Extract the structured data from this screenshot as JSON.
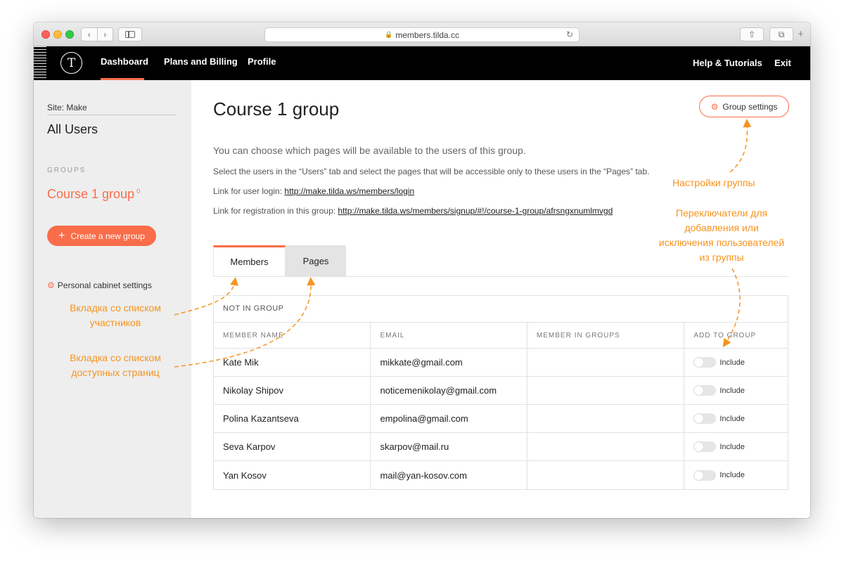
{
  "browser": {
    "url": "members.tilda.cc",
    "back_glyph": "‹",
    "forward_glyph": "›",
    "reload_glyph": "↻",
    "lock_glyph": "🔒",
    "share_glyph": "⇧",
    "tabs_glyph": "⧉",
    "new_tab_glyph": "+"
  },
  "appbar": {
    "logo_glyph": "T",
    "nav": [
      "Dashboard",
      "Plans and Billing",
      "Profile"
    ],
    "help_label": "Help & Tutorials",
    "exit_label": "Exit"
  },
  "sidebar": {
    "site_label": "Site: Make",
    "all_users": "All Users",
    "groups_heading": "GROUPS",
    "group_name": "Course 1 group",
    "group_count": "0",
    "create_group_label": "Create a new group",
    "cabinet_settings_label": "Personal cabinet settings"
  },
  "main": {
    "title": "Course 1 group",
    "group_settings_label": "Group settings",
    "lead": "You can choose which pages will be available to the users of this group.",
    "select_instruction": "Select the users in the “Users” tab and select the pages that will be accessible only to these users in the “Pages” tab.",
    "login_prefix": "Link for user login: ",
    "login_url": "http://make.tilda.ws/members/login",
    "reg_prefix": "Link for registration in this group: ",
    "reg_url": "http://make.tilda.ws/members/signup/#!/course-1-group/afrsngxnumlmvgd",
    "tabs": [
      "Members",
      "Pages"
    ]
  },
  "table": {
    "section_title": "NOT IN GROUP",
    "headers": [
      "MEMBER NAME",
      "EMAIL",
      "MEMBER IN GROUPS",
      "ADD TO GROUP"
    ],
    "rows": [
      {
        "name": "Kate Mik",
        "email": "mikkate@gmail.com",
        "groups": "",
        "toggle": "Include"
      },
      {
        "name": "Nikolay Shipov",
        "email": "noticemenikolay@gmail.com",
        "groups": "",
        "toggle": "Include"
      },
      {
        "name": "Polina Kazantseva",
        "email": "empolina@gmail.com",
        "groups": "",
        "toggle": "Include"
      },
      {
        "name": "Seva Karpov",
        "email": "skarpov@mail.ru",
        "groups": "",
        "toggle": "Include"
      },
      {
        "name": "Yan Kosov",
        "email": "mail@yan-kosov.com",
        "groups": "",
        "toggle": "Include"
      }
    ]
  },
  "annotations": {
    "members_tab_line1": "Вкладка со списком",
    "members_tab_line2": "участников",
    "pages_tab_line1": "Вкладка со списком",
    "pages_tab_line2": "доступных страниц",
    "group_settings": "Настройки группы",
    "toggles_line1": "Переключатели для",
    "toggles_line2": "добавления или",
    "toggles_line3": "исключения пользователей",
    "toggles_line4": "из группы"
  },
  "colors": {
    "accent": "#f96d4a",
    "annotation": "#f7931e",
    "appbar_bg": "#000000",
    "sidebar_bg": "#eeeeee"
  }
}
